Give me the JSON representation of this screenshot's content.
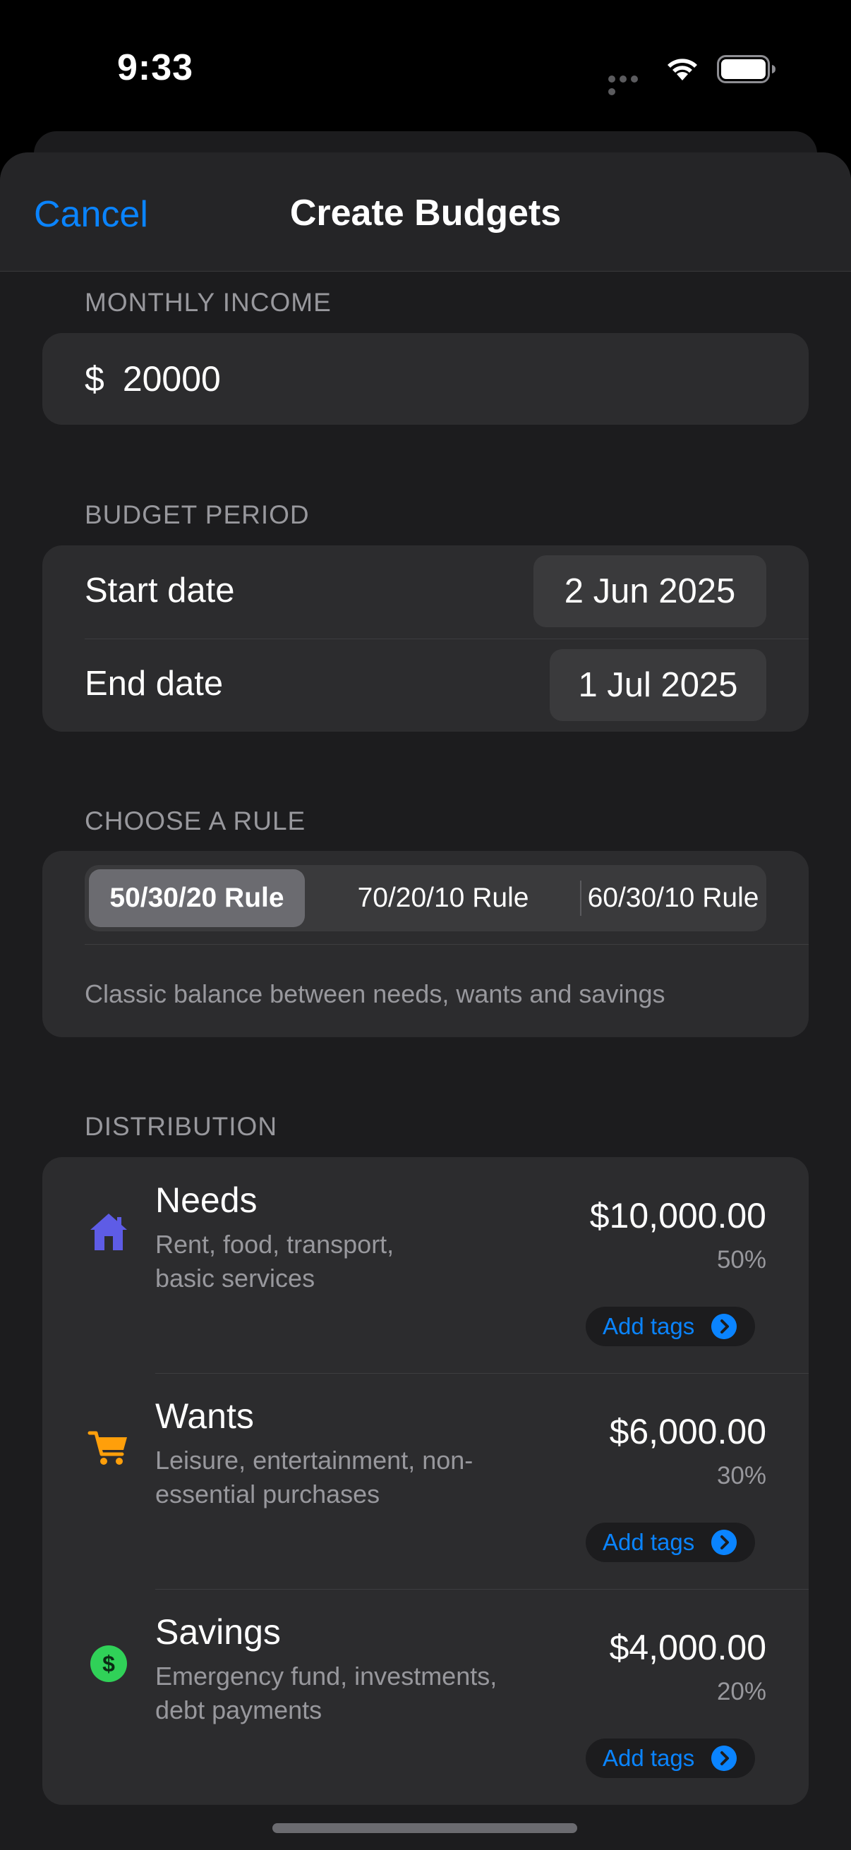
{
  "status": {
    "time": "9:33"
  },
  "nav": {
    "cancel": "Cancel",
    "title": "Create Budgets"
  },
  "income": {
    "label": "MONTHLY INCOME",
    "currency": "$",
    "value": "20000"
  },
  "period": {
    "label": "BUDGET PERIOD",
    "start_label": "Start date",
    "start_value": "2 Jun 2025",
    "end_label": "End date",
    "end_value": "1 Jul 2025"
  },
  "rule": {
    "label": "CHOOSE A RULE",
    "options": [
      "50/30/20 Rule",
      "70/20/10 Rule",
      "60/30/10 Rule"
    ],
    "selected": "50/30/20 Rule",
    "description": "Classic balance between needs, wants and savings"
  },
  "distribution": {
    "label": "DISTRIBUTION",
    "items": [
      {
        "name": "Needs",
        "desc_line1": "Rent, food, transport,",
        "desc_line2": "basic services",
        "amount": "$10,000.00",
        "percent": "50%",
        "tag_label": "Add tags",
        "icon": "house-icon",
        "color": "#5e5ce6"
      },
      {
        "name": "Wants",
        "desc_line1": "Leisure, entertainment, non-",
        "desc_line2": "essential purchases",
        "amount": "$6,000.00",
        "percent": "30%",
        "tag_label": "Add tags",
        "icon": "cart-icon",
        "color": "#ff9f0a"
      },
      {
        "name": "Savings",
        "desc_line1": "Emergency fund, investments,",
        "desc_line2": "debt payments",
        "amount": "$4,000.00",
        "percent": "20%",
        "tag_label": "Add tags",
        "icon": "dollar-circle-icon",
        "color": "#30d158"
      }
    ]
  },
  "colors": {
    "accent": "#0a84ff",
    "background": "#1c1c1e",
    "card": "#2c2c2e"
  }
}
